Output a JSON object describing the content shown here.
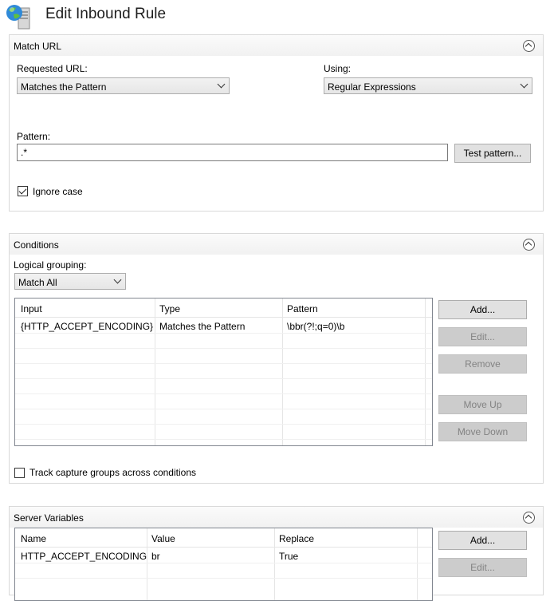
{
  "window": {
    "title": "Edit Inbound Rule"
  },
  "match_url": {
    "section_title": "Match URL",
    "requested_url_label": "Requested URL:",
    "requested_url_value": "Matches the Pattern",
    "using_label": "Using:",
    "using_value": "Regular Expressions",
    "pattern_label": "Pattern:",
    "pattern_value": ".*",
    "test_pattern_button": "Test pattern...",
    "ignore_case_label": "Ignore case",
    "ignore_case_checked": true
  },
  "conditions": {
    "section_title": "Conditions",
    "logical_grouping_label": "Logical grouping:",
    "logical_grouping_value": "Match All",
    "columns": [
      "Input",
      "Type",
      "Pattern"
    ],
    "rows": [
      {
        "input": "{HTTP_ACCEPT_ENCODING}",
        "type": "Matches the Pattern",
        "pattern": "\\bbr(?!;q=0)\\b"
      }
    ],
    "buttons": {
      "add": "Add...",
      "edit": "Edit...",
      "remove": "Remove",
      "move_up": "Move Up",
      "move_down": "Move Down"
    },
    "track_capture_label": "Track capture groups across conditions",
    "track_capture_checked": false
  },
  "server_variables": {
    "section_title": "Server Variables",
    "columns": [
      "Name",
      "Value",
      "Replace"
    ],
    "rows": [
      {
        "name": "HTTP_ACCEPT_ENCODING",
        "value": "br",
        "replace": "True"
      }
    ],
    "buttons": {
      "add": "Add...",
      "edit": "Edit..."
    }
  },
  "icons": {
    "app_icon": "globe-server-icon",
    "collapse_icon": "chevron-up-circle-icon"
  }
}
